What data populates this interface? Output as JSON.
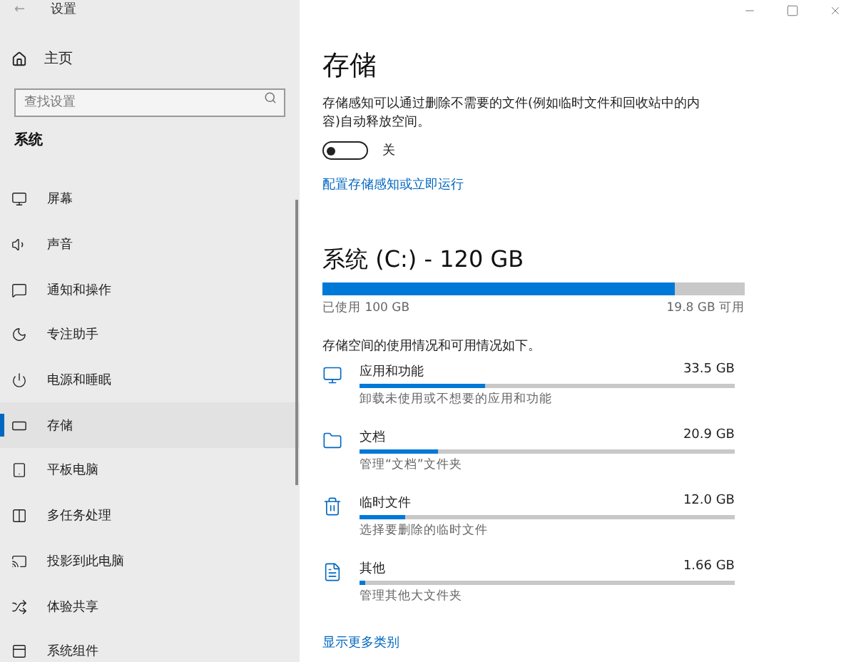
{
  "window": {
    "title": "设置",
    "back": "←",
    "controls": [
      {
        "kind": "minimize"
      },
      {
        "kind": "maximize"
      },
      {
        "kind": "close"
      }
    ]
  },
  "sidebar": {
    "home": "主页",
    "search": {
      "placeholder": "查找设置"
    },
    "section": "系统",
    "items": [
      {
        "label": "屏幕",
        "kind": "monitor",
        "selected": false
      },
      {
        "label": "声音",
        "kind": "sound",
        "selected": false
      },
      {
        "label": "通知和操作",
        "kind": "message",
        "selected": false
      },
      {
        "label": "专注助手",
        "kind": "moon",
        "selected": false
      },
      {
        "label": "电源和睡眠",
        "kind": "power",
        "selected": false
      },
      {
        "label": "存储",
        "kind": "storage",
        "selected": true
      },
      {
        "label": "平板电脑",
        "kind": "tablet",
        "selected": false
      },
      {
        "label": "多任务处理",
        "kind": "multitask",
        "selected": false
      },
      {
        "label": "投影到此电脑",
        "kind": "project",
        "selected": false
      },
      {
        "label": "体验共享",
        "kind": "share",
        "selected": false
      },
      {
        "label": "系统组件",
        "kind": "component",
        "selected": false
      }
    ]
  },
  "page": {
    "title": "存储",
    "description": "存储感知可以通过删除不需要的文件(例如临时文件和回收站中的内容)自动释放空间。",
    "toggle": {
      "on": false,
      "label": "关"
    },
    "link": "配置存储感知或立即运行",
    "drive": {
      "title": "系统 (C:) - 120 GB",
      "level": 0.835,
      "used": "已使用 100 GB",
      "free": "19.8 GB 可用",
      "summary": "存储空间的使用情况和可用情况如下。"
    },
    "categories": [
      {
        "kind": "apps",
        "name": "应用和功能",
        "size": "33.5 GB",
        "level": 0.335,
        "hint": "卸载未使用或不想要的应用和功能"
      },
      {
        "kind": "documents",
        "name": "文档",
        "size": "20.9 GB",
        "level": 0.21,
        "hint": "管理“文档”文件夹"
      },
      {
        "kind": "trash",
        "name": "临时文件",
        "size": "12.0 GB",
        "level": 0.12,
        "hint": "选择要删除的临时文件"
      },
      {
        "kind": "other",
        "name": "其他",
        "size": "1.66 GB",
        "level": 0.017,
        "hint": "管理其他大文件夹"
      }
    ],
    "more": "显示更多类别"
  }
}
